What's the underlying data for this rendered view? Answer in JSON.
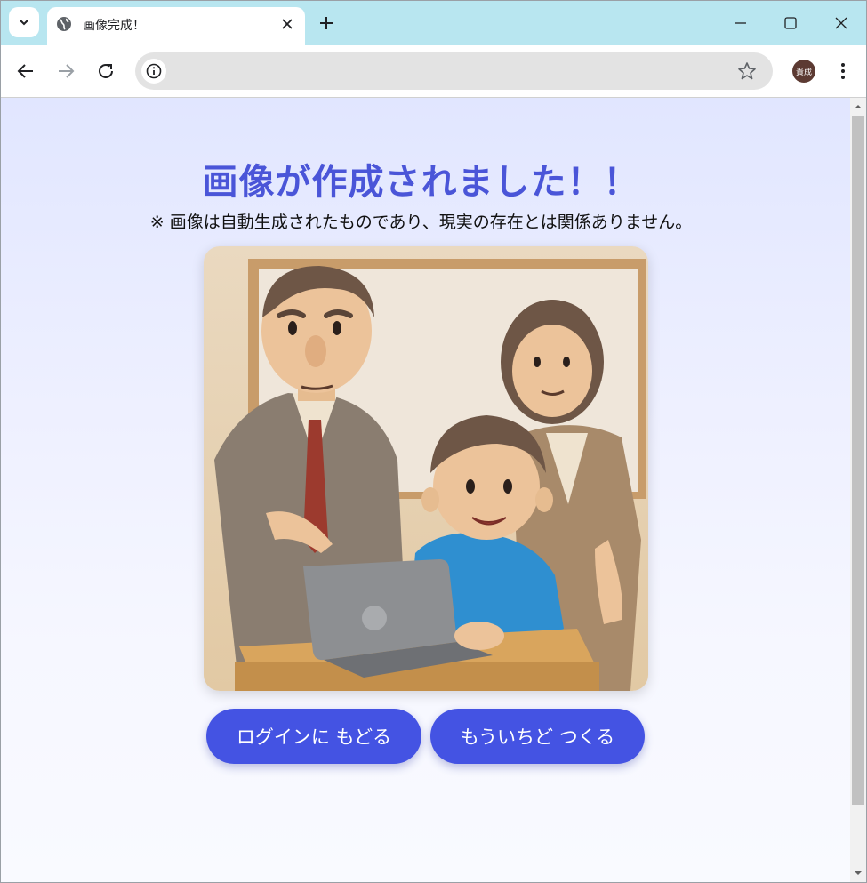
{
  "browser": {
    "tab_title": "画像完成！",
    "avatar_text": "貴成",
    "address": ""
  },
  "page": {
    "heading": "画像が作成されました！！",
    "note": "※ 画像は自動生成されたものであり、現実の存在とは関係ありません。",
    "buttons": {
      "back_to_login": "ログインに もどる",
      "create_again": "もういちど つくる"
    },
    "image_alt": "clay-style illustration of a man, a woman and a boy at a laptop"
  },
  "colors": {
    "accent": "#4453e3",
    "heading": "#4a55d8",
    "titlebar": "#b8e6f0"
  }
}
